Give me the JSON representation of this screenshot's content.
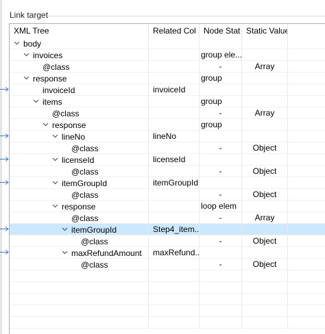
{
  "group_title": "Link target",
  "columns": [
    "XML Tree",
    "Related Col",
    "Node Stat",
    "Static Value"
  ],
  "colors": {
    "selected_row": "#cce8ff",
    "link_arrow": "#3b78c9"
  },
  "rows": [
    {
      "depth": 0,
      "expanded": true,
      "label": "body",
      "related": "",
      "stat": "",
      "value": ""
    },
    {
      "depth": 1,
      "expanded": true,
      "label": "invoices",
      "related": "",
      "stat": "group ele...",
      "value": ""
    },
    {
      "depth": 2,
      "expanded": null,
      "label": "@class",
      "related": "",
      "stat": "-",
      "value": "Array"
    },
    {
      "depth": 1,
      "expanded": true,
      "label": "response",
      "related": "",
      "stat": "group",
      "value": ""
    },
    {
      "depth": 2,
      "expanded": null,
      "label": "invoiceId",
      "related": "invoiceId",
      "stat": "",
      "value": "",
      "linked": true
    },
    {
      "depth": 2,
      "expanded": true,
      "label": "items",
      "related": "",
      "stat": "group",
      "value": ""
    },
    {
      "depth": 3,
      "expanded": null,
      "label": "@class",
      "related": "",
      "stat": "-",
      "value": "Array"
    },
    {
      "depth": 3,
      "expanded": true,
      "label": "response",
      "related": "",
      "stat": "group",
      "value": ""
    },
    {
      "depth": 4,
      "expanded": true,
      "label": "lineNo",
      "related": "lineNo",
      "stat": "",
      "value": "",
      "linked": true
    },
    {
      "depth": 5,
      "expanded": null,
      "label": "@class",
      "related": "",
      "stat": "-",
      "value": "Object"
    },
    {
      "depth": 4,
      "expanded": true,
      "label": "licenseId",
      "related": "licenseId",
      "stat": "",
      "value": "",
      "linked": true
    },
    {
      "depth": 5,
      "expanded": null,
      "label": "@class",
      "related": "",
      "stat": "-",
      "value": "Object"
    },
    {
      "depth": 4,
      "expanded": true,
      "label": "itemGroupId",
      "related": "itemGroupId",
      "stat": "",
      "value": "",
      "linked": true
    },
    {
      "depth": 5,
      "expanded": null,
      "label": "@class",
      "related": "",
      "stat": "-",
      "value": "Object"
    },
    {
      "depth": 4,
      "expanded": true,
      "label": "response",
      "related": "",
      "stat": "loop elem",
      "value": ""
    },
    {
      "depth": 5,
      "expanded": null,
      "label": "@class",
      "related": "",
      "stat": "-",
      "value": "Array"
    },
    {
      "depth": 5,
      "expanded": true,
      "label": "itemGroupId",
      "related": "Step4_item...",
      "stat": "",
      "value": "",
      "linked": true,
      "selected": true
    },
    {
      "depth": 6,
      "expanded": null,
      "label": "@class",
      "related": "",
      "stat": "-",
      "value": "Object"
    },
    {
      "depth": 5,
      "expanded": true,
      "label": "maxRefundAmount",
      "related": "maxRefund...",
      "stat": "",
      "value": "",
      "linked": true
    },
    {
      "depth": 6,
      "expanded": null,
      "label": "@class",
      "related": "",
      "stat": "-",
      "value": "Object"
    },
    {
      "depth": null,
      "label": "",
      "related": "",
      "stat": "",
      "value": ""
    },
    {
      "depth": null,
      "label": "",
      "related": "",
      "stat": "",
      "value": ""
    },
    {
      "depth": null,
      "label": "",
      "related": "",
      "stat": "",
      "value": ""
    },
    {
      "depth": null,
      "label": "",
      "related": "",
      "stat": "",
      "value": ""
    },
    {
      "depth": null,
      "label": "",
      "related": "",
      "stat": "",
      "value": ""
    }
  ]
}
